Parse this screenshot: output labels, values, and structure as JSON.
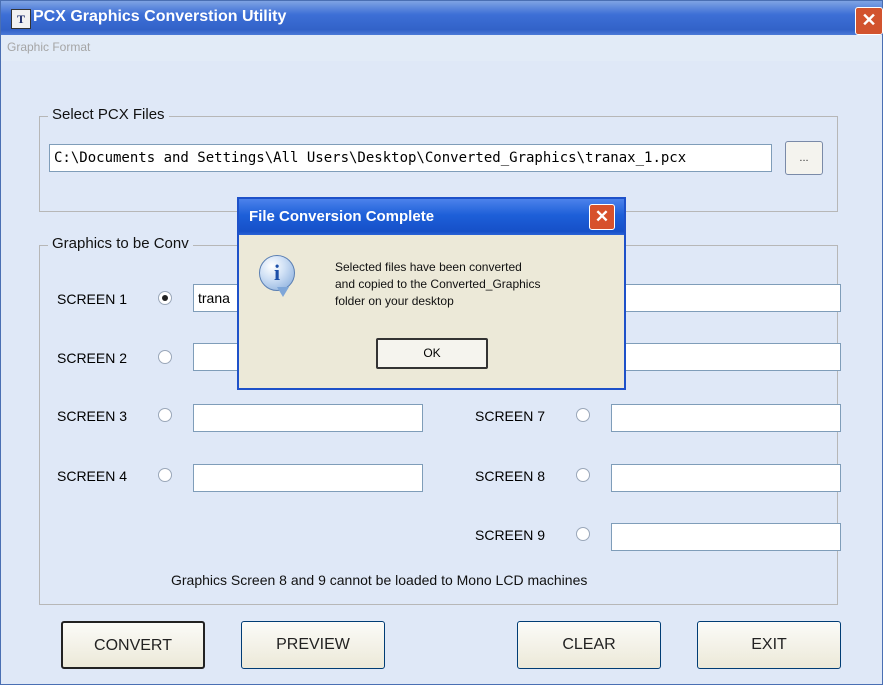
{
  "window": {
    "logo": "T",
    "title": "PCX Graphics Converstion Utility",
    "close_glyph": "✕"
  },
  "menu": {
    "items": [
      "Graphic Format"
    ]
  },
  "select_files": {
    "group_label": "Select PCX Files",
    "path_value": "C:\\Documents and Settings\\All Users\\Desktop\\Converted_Graphics\\tranax_1.pcx",
    "browse_label": "..."
  },
  "graphics": {
    "group_label": "Graphics to be Conv",
    "screens": [
      {
        "label": "SCREEN 1",
        "value": "trana",
        "selected": true
      },
      {
        "label": "SCREEN 2",
        "value": "",
        "selected": false
      },
      {
        "label": "SCREEN 3",
        "value": "",
        "selected": false
      },
      {
        "label": "SCREEN 4",
        "value": "",
        "selected": false
      },
      {
        "label": "SCREEN 7",
        "value": "",
        "selected": false
      },
      {
        "label": "SCREEN 8",
        "value": "",
        "selected": false
      },
      {
        "label": "SCREEN 9",
        "value": "",
        "selected": false
      }
    ],
    "note": "Graphics Screen 8 and 9 cannot be loaded to Mono LCD machines"
  },
  "buttons": {
    "convert": "CONVERT",
    "preview": "PREVIEW",
    "clear": "CLEAR",
    "exit": "EXIT"
  },
  "dialog": {
    "title": "File Conversion Complete",
    "close_glyph": "✕",
    "icon_glyph": "i",
    "message_lines": [
      "Selected files have been converted",
      "and copied to the Converted_Graphics",
      "folder on your desktop"
    ],
    "ok_label": "OK"
  }
}
